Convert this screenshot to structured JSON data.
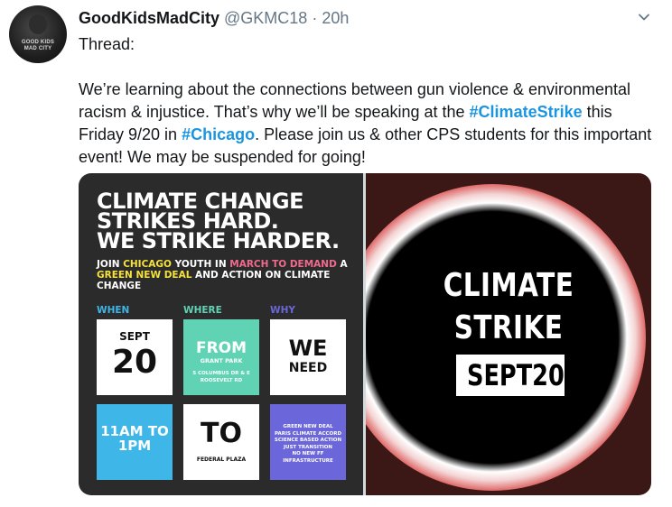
{
  "tweet": {
    "display_name": "GoodKidsMadCity",
    "handle": "@GKMC18",
    "separator": "·",
    "time": "20h",
    "line_thread": "Thread:",
    "body_part1": "We’re learning about the connections between gun violence & environmental racism & injustice. That’s why we’ll be speaking at the ",
    "hashtag1": "#ClimateStrike",
    "body_part2": " this Friday 9/20 in ",
    "hashtag2": "#Chicago",
    "body_part3": ". Please join us & other CPS students for this important event! We may be suspended for going!",
    "avatar_text": "GOOD KIDS MAD CITY",
    "menu_icon": "chevron-down-icon"
  },
  "poster_left": {
    "title": "CLIMATE CHANGE\nSTRIKES HARD.\nWE STRIKE HARDER.",
    "sub_1": "JOIN ",
    "sub_chicago": "CHICAGO",
    "sub_2": " YOUTH IN ",
    "sub_march": "MARCH TO DEMAND",
    "sub_3": " A ",
    "sub_gnd": "GREEN NEW DEAL",
    "sub_4": " AND ACTION ON CLIMATE CHANGE",
    "label_when": "WHEN",
    "label_where": "WHERE",
    "label_why": "WHY",
    "tile_sept": "SEPT",
    "tile_20": "20",
    "tile_from": "FROM",
    "tile_grant_park": "GRANT PARK",
    "tile_address": "S COLUMBUS DR & E ROOSEVELT RD",
    "tile_we": "WE",
    "tile_need": "NEED",
    "tile_time": "11AM TO\n1PM",
    "tile_to": "TO",
    "tile_federal": "FEDERAL PLAZA",
    "tile_needs": "GREEN NEW DEAL\nPARIS CLIMATE ACCORD\nSCIENCE BASED ACTION\nJUST TRANSITION\nNO NEW FF INFRASTRUCTURE",
    "colors": {
      "when": "#3fb6e8",
      "where": "#5fd3b4",
      "why": "#6b66d9",
      "yellow": "#f5e23a",
      "pink": "#f06a8e"
    }
  },
  "poster_right": {
    "line1": "CLIMATE",
    "line2": "STRIKE",
    "date": "SEPT20"
  }
}
